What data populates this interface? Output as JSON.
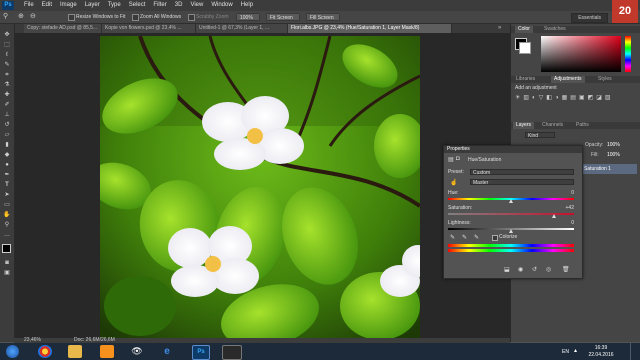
{
  "app": {
    "logo": "Ps"
  },
  "menu": [
    "File",
    "Edit",
    "Image",
    "Layer",
    "Type",
    "Select",
    "Filter",
    "3D",
    "View",
    "Window",
    "Help"
  ],
  "options": {
    "resize_windows": "Resize Windows to Fit",
    "zoom_all_windows": "Zoom All Windows",
    "scrubby_zoom": "Scrubby Zoom",
    "zoom_value": "100%",
    "fit_screen": "Fit Screen",
    "fill_screen": "Fill Screen",
    "workspace": "Essentials"
  },
  "tabs": [
    {
      "label": "Copy: stefade AD.psd @ 85,5..."
    },
    {
      "label": "Kopie von flowers.psd @ 23,4% ..."
    },
    {
      "label": "Untitled-1 @ 67,3% (Layer 1, ..."
    },
    {
      "label": "Flori.albs.JPG @ 23,4% (Hue/Saturation 1, Layer Mask/8)"
    }
  ],
  "status": {
    "zoom": "23,46%",
    "doc": "Doc: 26,6M/26,6M"
  },
  "dock": {
    "color_tab": "Color",
    "swatches_tab": "Swatches",
    "libraries_tab": "Libraries",
    "adjustments_tab": "Adjustments",
    "styles_tab": "Styles",
    "add_adjustment": "Add an adjustment",
    "layers_tab": "Layers",
    "channels_tab": "Channels",
    "paths_tab": "Paths",
    "kind_label": "Kind",
    "opacity_label": "Opacity:",
    "opacity_value": "100%",
    "fill_label": "Fill:",
    "fill_value": "100%",
    "layer_name": "Saturation 1"
  },
  "properties": {
    "title": "Properties",
    "adjustment_name": "Hue/Saturation",
    "preset_label": "Preset:",
    "preset_value": "Custom",
    "channel_value": "Master",
    "hue_label": "Hue:",
    "hue_value": "0",
    "saturation_label": "Saturation:",
    "saturation_value": "+42",
    "lightness_label": "Lightness:",
    "lightness_value": "0",
    "colorize_label": "Colorize"
  },
  "taskbar": {
    "lang": "EN",
    "time": "16:39",
    "date": "22.04.2016",
    "corner": "20"
  },
  "colors": {
    "accent": "#31a8ff",
    "saturation_track": "#c8102e",
    "taskbar": "#1d2a3a"
  }
}
